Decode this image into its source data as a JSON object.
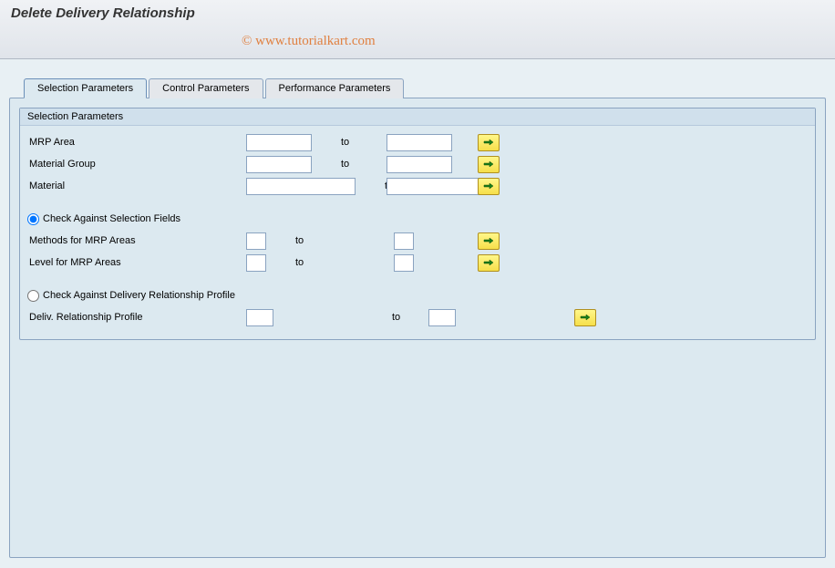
{
  "header": {
    "title": "Delete Delivery Relationship"
  },
  "watermark": "© www.tutorialkart.com",
  "tabs": {
    "items": [
      {
        "label": "Selection Parameters",
        "active": true
      },
      {
        "label": "Control Parameters",
        "active": false
      },
      {
        "label": "Performance Parameters",
        "active": false
      }
    ]
  },
  "groupbox": {
    "title": "Selection Parameters"
  },
  "fields": {
    "mrp_area": {
      "label": "MRP Area",
      "from": "",
      "to_label": "to",
      "to": ""
    },
    "mat_group": {
      "label": "Material Group",
      "from": "",
      "to_label": "to",
      "to": ""
    },
    "material": {
      "label": "Material",
      "from": "",
      "to_label": "to",
      "to": ""
    },
    "radio1": {
      "label": "Check Against Selection Fields",
      "checked": true
    },
    "methods": {
      "label": "Methods for MRP Areas",
      "from": "",
      "to_label": "to",
      "to": ""
    },
    "level": {
      "label": "Level for MRP Areas",
      "from": "",
      "to_label": "to",
      "to": ""
    },
    "radio2": {
      "label": "Check Against Delivery Relationship Profile",
      "checked": false
    },
    "profile": {
      "label": "Deliv. Relationship Profile",
      "from": "",
      "to_label": "to",
      "to": ""
    }
  },
  "icons": {
    "multi_select": "arrow-right-icon"
  }
}
